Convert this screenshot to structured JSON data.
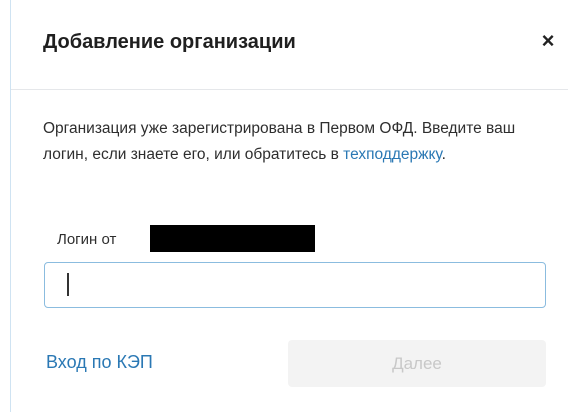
{
  "dialog": {
    "title": "Добавление организации",
    "close_label": "×"
  },
  "message": {
    "text_before_link": "Организация уже зарегистрирована в Первом ОФД. Введите ваш логин, если знаете его, или обратитесь в ",
    "link_text": "техподдержку",
    "text_after_link": "."
  },
  "login": {
    "label": "Логин от",
    "value": "",
    "placeholder": ""
  },
  "actions": {
    "kep_link": "Вход по КЭП",
    "next_button": "Далее"
  },
  "colors": {
    "link": "#2a78b4",
    "input_border": "#8bbcdf",
    "button_disabled_bg": "#f3f3f3",
    "button_disabled_text": "#c8c8c8"
  }
}
